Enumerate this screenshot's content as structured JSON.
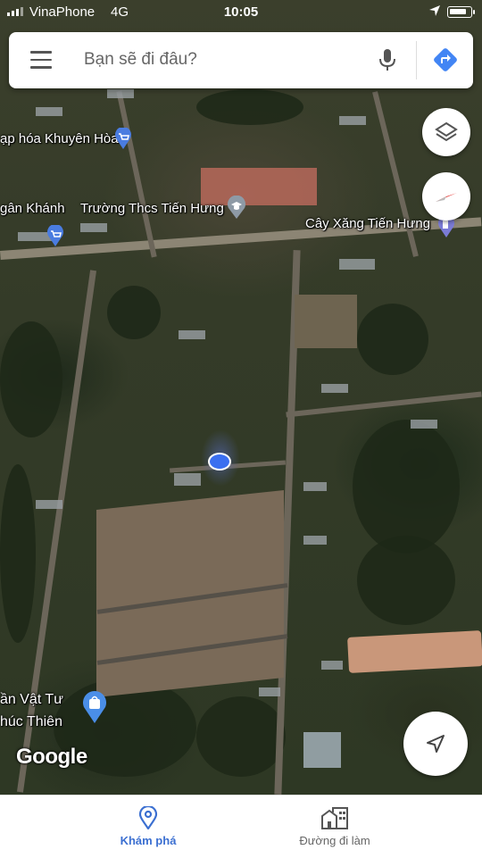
{
  "status_bar": {
    "carrier": "VinaPhone",
    "network": "4G",
    "time": "10:05",
    "battery_level": 0.85
  },
  "search": {
    "placeholder": "Bạn sẽ đi đâu?",
    "menu_icon": "menu-icon",
    "mic_icon": "mic-icon",
    "directions_icon": "directions-icon"
  },
  "map": {
    "labels": [
      "ạp hóa Khuyên Hòa",
      "gân Khánh",
      "Trường Thcs Tiến Hưng",
      "Cây Xăng Tiến Hưng",
      "ần Vật Tư",
      "húc Thiên"
    ],
    "attribution": "Google"
  },
  "bottom_nav": {
    "tabs": [
      {
        "label": "Khám phá",
        "icon": "location-pin-icon",
        "active": true
      },
      {
        "label": "Đường đi làm",
        "icon": "commute-buildings-icon",
        "active": false
      }
    ]
  },
  "colors": {
    "accent": "#3b6fd1",
    "location_dot": "#3b6ff0",
    "directions": "#4285f4"
  }
}
